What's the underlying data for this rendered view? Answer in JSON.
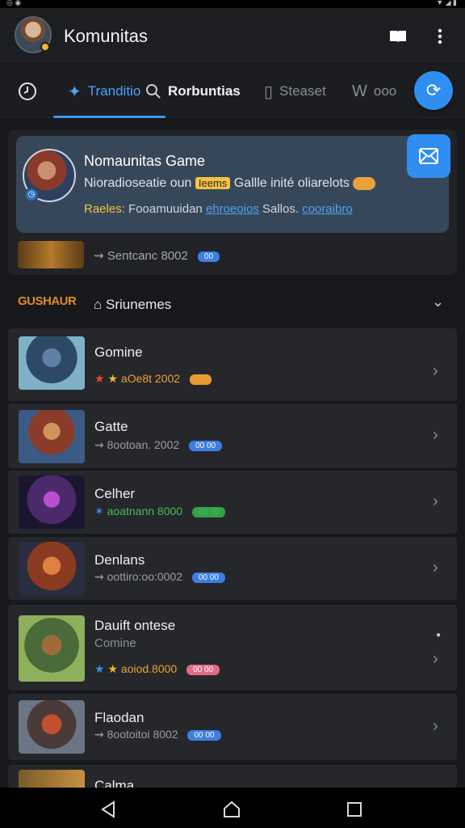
{
  "app": {
    "title": "Komunitas",
    "colors": {
      "accent": "#2f8ef0",
      "background": "#17181b",
      "card": "#37475a"
    }
  },
  "header": {
    "icons": [
      "book-icon",
      "more-vertical-icon"
    ]
  },
  "tabs": [
    {
      "icon": "clock-icon",
      "label": ""
    },
    {
      "icon": "sparkle-icon",
      "label": "Tranditio",
      "active": true
    },
    {
      "icon": "search-icon",
      "label": "Rorbuntias"
    },
    {
      "icon": "square-icon",
      "label": "Steaset"
    },
    {
      "icon": "logo-icon",
      "label": "ooo"
    }
  ],
  "featured": {
    "title": "Nomaunitas Game",
    "desc_before": "Nioradioseatie oun",
    "desc_highlight": "Ieems",
    "desc_after": "Gallle inité oliarelots",
    "links": {
      "l1": "Raeles:",
      "l2": "Fooamuuidan",
      "l3": "ehroeoios",
      "l4": "Sallos.",
      "l5": "cooraibro"
    },
    "sub_text": "Sentcanc 8002",
    "sub_pill": "00"
  },
  "section": {
    "logo_text": "GUSHAUR",
    "title": "Sriunemes"
  },
  "items": [
    {
      "title": "Gomine",
      "sub": "",
      "meta": "aOe8t 2002",
      "pill": "00",
      "pill_color": "orange"
    },
    {
      "title": "Gatte",
      "sub": "",
      "meta": "8ootoan. 2002",
      "pill": "00 00",
      "pill_color": "blue"
    },
    {
      "title": "Celher",
      "sub": "",
      "meta": "aoatnann 8000",
      "pill": "00 00",
      "pill_color": "green"
    },
    {
      "title": "Denlans",
      "sub": "",
      "meta": "oottiro:oo:0002",
      "pill": "00 00",
      "pill_color": "blue"
    },
    {
      "title": "Dauift ontese",
      "sub": "Comine",
      "meta": "aoiod.8000",
      "pill": "00 00",
      "pill_color": "pink"
    },
    {
      "title": "Flaodan",
      "sub": "",
      "meta": "8ootoitoi 8002",
      "pill": "00 00",
      "pill_color": "blue"
    },
    {
      "title": "Calma",
      "sub": "",
      "meta": "",
      "pill": "",
      "pill_color": "blue"
    }
  ],
  "nav": [
    "back-icon",
    "home-icon",
    "recents-icon"
  ]
}
